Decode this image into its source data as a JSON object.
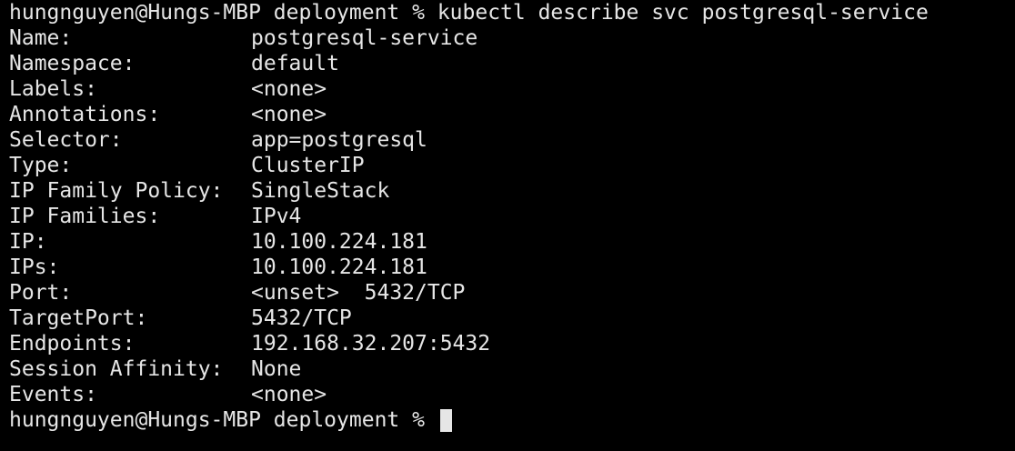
{
  "terminal": {
    "prompt": "hungnguyen@Hungs-MBP deployment % ",
    "command": "kubectl describe svc postgresql-service",
    "fields": [
      {
        "key": "Name:",
        "value": "postgresql-service"
      },
      {
        "key": "Namespace:",
        "value": "default"
      },
      {
        "key": "Labels:",
        "value": "<none>"
      },
      {
        "key": "Annotations:",
        "value": "<none>"
      },
      {
        "key": "Selector:",
        "value": "app=postgresql"
      },
      {
        "key": "Type:",
        "value": "ClusterIP"
      },
      {
        "key": "IP Family Policy:",
        "value": "SingleStack"
      },
      {
        "key": "IP Families:",
        "value": "IPv4"
      },
      {
        "key": "IP:",
        "value": "10.100.224.181"
      },
      {
        "key": "IPs:",
        "value": "10.100.224.181"
      },
      {
        "key": "Port:",
        "value": "<unset>  5432/TCP"
      },
      {
        "key": "TargetPort:",
        "value": "5432/TCP"
      },
      {
        "key": "Endpoints:",
        "value": "192.168.32.207:5432"
      },
      {
        "key": "Session Affinity:",
        "value": "None"
      },
      {
        "key": "Events:",
        "value": "<none>"
      }
    ],
    "final_prompt": "hungnguyen@Hungs-MBP deployment % ",
    "colors": {
      "background": "#000000",
      "foreground": "#e6e6e6"
    }
  }
}
